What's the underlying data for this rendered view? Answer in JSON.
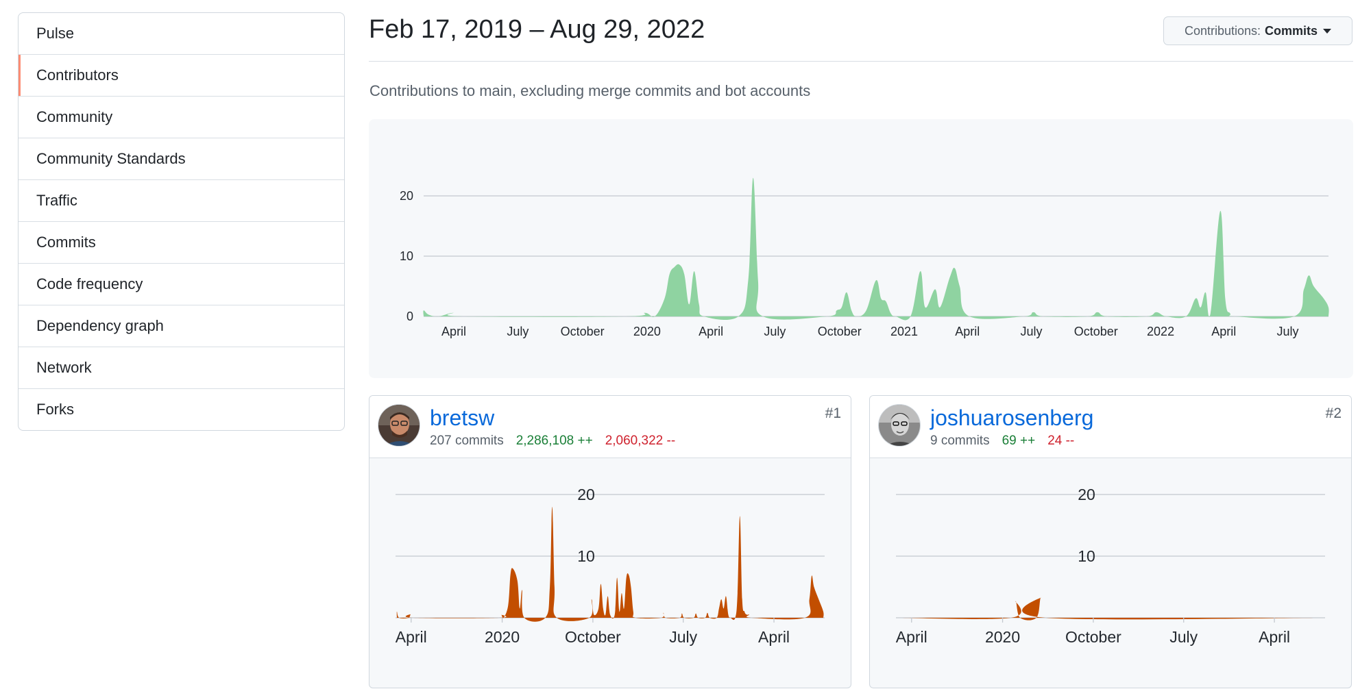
{
  "sidebar": {
    "items": [
      {
        "label": "Pulse"
      },
      {
        "label": "Contributors",
        "selected": true
      },
      {
        "label": "Community"
      },
      {
        "label": "Community Standards"
      },
      {
        "label": "Traffic"
      },
      {
        "label": "Commits"
      },
      {
        "label": "Code frequency"
      },
      {
        "label": "Dependency graph"
      },
      {
        "label": "Network"
      },
      {
        "label": "Forks"
      }
    ]
  },
  "header": {
    "date_range": "Feb 17, 2019 – Aug 29, 2022",
    "contributions_prefix": "Contributions:",
    "contributions_value": "Commits",
    "subtitle": "Contributions to main, excluding merge commits and bot accounts"
  },
  "colors": {
    "main_area": "#8fd3a1",
    "contributor_area": "#c24e00",
    "link": "#0969da",
    "additions": "#1a7f37",
    "deletions": "#cf222e",
    "selected_marker": "#fd8c73"
  },
  "chart_data": [
    {
      "type": "area",
      "scope": "all-contributors",
      "x_ticks": [
        "April",
        "July",
        "October",
        "2020",
        "April",
        "July",
        "October",
        "2021",
        "April",
        "July",
        "October",
        "2022",
        "April",
        "July"
      ],
      "y_ticks": [
        0,
        10,
        20
      ],
      "ylim": [
        0,
        20
      ],
      "points": [
        [
          "2019-02-17",
          1
        ],
        [
          "2019-02-24",
          0.3
        ],
        [
          "2019-03-10",
          0
        ],
        [
          "2019-03-31",
          0.6
        ],
        [
          "2019-04-14",
          0
        ],
        [
          "2019-12-01",
          0
        ],
        [
          "2019-12-29",
          0.6
        ],
        [
          "2020-01-12",
          0
        ],
        [
          "2020-01-26",
          3
        ],
        [
          "2020-02-02",
          7
        ],
        [
          "2020-02-09",
          8.2
        ],
        [
          "2020-02-16",
          8.6
        ],
        [
          "2020-02-23",
          7
        ],
        [
          "2020-03-01",
          2
        ],
        [
          "2020-03-08",
          7.5
        ],
        [
          "2020-03-15",
          2
        ],
        [
          "2020-03-22",
          0
        ],
        [
          "2020-05-10",
          0
        ],
        [
          "2020-05-24",
          6
        ],
        [
          "2020-05-31",
          23
        ],
        [
          "2020-06-07",
          6
        ],
        [
          "2020-06-14",
          0
        ],
        [
          "2020-09-13",
          0
        ],
        [
          "2020-09-27",
          1
        ],
        [
          "2020-10-04",
          1.5
        ],
        [
          "2020-10-11",
          4
        ],
        [
          "2020-10-18",
          1
        ],
        [
          "2020-10-25",
          0
        ],
        [
          "2020-11-08",
          1
        ],
        [
          "2020-11-22",
          6
        ],
        [
          "2020-11-29",
          3
        ],
        [
          "2020-12-06",
          2.5
        ],
        [
          "2020-12-13",
          0.5
        ],
        [
          "2020-12-20",
          0
        ],
        [
          "2021-01-10",
          0
        ],
        [
          "2021-01-24",
          7.5
        ],
        [
          "2021-01-31",
          1.5
        ],
        [
          "2021-02-14",
          4.5
        ],
        [
          "2021-02-21",
          1.5
        ],
        [
          "2021-03-07",
          6.5
        ],
        [
          "2021-03-14",
          8
        ],
        [
          "2021-03-21",
          5
        ],
        [
          "2021-04-04",
          0
        ],
        [
          "2021-06-20",
          0
        ],
        [
          "2021-07-04",
          0.7
        ],
        [
          "2021-07-18",
          0
        ],
        [
          "2021-09-19",
          0
        ],
        [
          "2021-10-03",
          0.7
        ],
        [
          "2021-10-17",
          0
        ],
        [
          "2021-12-12",
          0
        ],
        [
          "2021-12-26",
          0.7
        ],
        [
          "2022-01-09",
          0
        ],
        [
          "2022-02-06",
          0
        ],
        [
          "2022-02-20",
          3
        ],
        [
          "2022-02-27",
          1.5
        ],
        [
          "2022-03-06",
          4
        ],
        [
          "2022-03-13",
          0.5
        ],
        [
          "2022-03-27",
          17.5
        ],
        [
          "2022-04-03",
          3
        ],
        [
          "2022-04-10",
          0.5
        ],
        [
          "2022-04-17",
          0
        ],
        [
          "2022-07-10",
          0
        ],
        [
          "2022-07-24",
          4.5
        ],
        [
          "2022-07-31",
          6.8
        ],
        [
          "2022-08-07",
          5
        ],
        [
          "2022-08-21",
          3
        ],
        [
          "2022-08-28",
          1.5
        ]
      ]
    },
    {
      "type": "area",
      "scope": "bretsw",
      "x_ticks": [
        "April",
        "2020",
        "October",
        "July",
        "April"
      ],
      "y_ticks": [
        10,
        20
      ],
      "ylim": [
        0,
        20
      ],
      "points": [
        [
          "2019-02-17",
          1
        ],
        [
          "2019-02-24",
          0
        ],
        [
          "2019-03-24",
          0
        ],
        [
          "2019-03-31",
          0.6
        ],
        [
          "2019-04-07",
          0
        ],
        [
          "2019-12-22",
          0
        ],
        [
          "2019-12-29",
          0.5
        ],
        [
          "2020-01-05",
          0
        ],
        [
          "2020-01-19",
          2
        ],
        [
          "2020-01-26",
          7
        ],
        [
          "2020-02-02",
          8
        ],
        [
          "2020-02-16",
          6
        ],
        [
          "2020-02-23",
          1.5
        ],
        [
          "2020-03-01",
          4.5
        ],
        [
          "2020-03-08",
          0
        ],
        [
          "2020-05-10",
          0
        ],
        [
          "2020-05-24",
          5
        ],
        [
          "2020-05-31",
          18
        ],
        [
          "2020-06-07",
          5
        ],
        [
          "2020-06-14",
          0
        ],
        [
          "2020-09-20",
          0
        ],
        [
          "2020-09-27",
          3
        ],
        [
          "2020-10-04",
          0.5
        ],
        [
          "2020-10-18",
          1.5
        ],
        [
          "2020-10-25",
          5.5
        ],
        [
          "2020-11-01",
          1.5
        ],
        [
          "2020-11-08",
          0.5
        ],
        [
          "2020-11-15",
          3.5
        ],
        [
          "2020-11-22",
          0.5
        ],
        [
          "2020-12-06",
          0.5
        ],
        [
          "2020-12-13",
          6.5
        ],
        [
          "2020-12-20",
          1
        ],
        [
          "2020-12-27",
          4
        ],
        [
          "2021-01-03",
          1.5
        ],
        [
          "2021-01-10",
          6.5
        ],
        [
          "2021-01-17",
          7
        ],
        [
          "2021-01-24",
          5
        ],
        [
          "2021-01-31",
          1
        ],
        [
          "2021-02-07",
          0
        ],
        [
          "2021-04-25",
          0
        ],
        [
          "2021-05-02",
          0.8
        ],
        [
          "2021-05-09",
          0
        ],
        [
          "2021-06-20",
          0
        ],
        [
          "2021-06-27",
          0.7
        ],
        [
          "2021-07-04",
          0
        ],
        [
          "2021-08-01",
          0
        ],
        [
          "2021-08-08",
          0.7
        ],
        [
          "2021-08-15",
          0
        ],
        [
          "2021-09-05",
          0
        ],
        [
          "2021-09-12",
          0.8
        ],
        [
          "2021-09-19",
          0
        ],
        [
          "2021-10-10",
          0
        ],
        [
          "2021-10-17",
          1.5
        ],
        [
          "2021-10-24",
          3
        ],
        [
          "2021-10-31",
          1.5
        ],
        [
          "2021-11-07",
          3.5
        ],
        [
          "2021-11-14",
          0.5
        ],
        [
          "2021-11-21",
          0
        ],
        [
          "2021-12-05",
          0
        ],
        [
          "2021-12-12",
          4
        ],
        [
          "2021-12-19",
          16.5
        ],
        [
          "2021-12-26",
          3
        ],
        [
          "2022-01-02",
          1
        ],
        [
          "2022-01-09",
          0.5
        ],
        [
          "2022-01-16",
          0.5
        ],
        [
          "2022-01-23",
          0
        ],
        [
          "2022-07-03",
          0
        ],
        [
          "2022-07-17",
          3
        ],
        [
          "2022-07-24",
          6.8
        ],
        [
          "2022-07-31",
          5
        ],
        [
          "2022-08-14",
          3
        ],
        [
          "2022-08-28",
          1
        ]
      ]
    },
    {
      "type": "area",
      "scope": "joshuarosenberg",
      "x_ticks": [
        "April",
        "2020",
        "October",
        "July",
        "April"
      ],
      "y_ticks": [
        10,
        20
      ],
      "ylim": [
        0,
        20
      ],
      "points": [
        [
          "2020-01-26",
          0
        ],
        [
          "2020-02-09",
          2.7
        ],
        [
          "2020-02-23",
          0
        ],
        [
          "2020-04-12",
          0
        ],
        [
          "2020-04-26",
          3.3
        ],
        [
          "2020-05-10",
          0
        ]
      ]
    }
  ],
  "contributors": [
    {
      "rank": "#1",
      "username": "bretsw",
      "commits": "207 commits",
      "additions": "2,286,108 ++",
      "deletions": "2,060,322 --",
      "avatar": "person-photo"
    },
    {
      "rank": "#2",
      "username": "joshuarosenberg",
      "commits": "9 commits",
      "additions": "69 ++",
      "deletions": "24 --",
      "avatar": "person-photo-grayscale"
    }
  ]
}
